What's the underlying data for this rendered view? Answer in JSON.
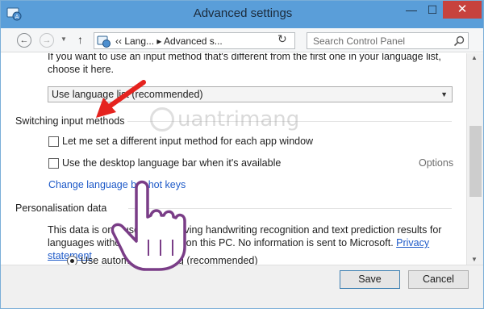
{
  "window": {
    "title": "Advanced settings",
    "minimize": "—",
    "maximize": "☐",
    "close": "✕"
  },
  "toolbar": {
    "back_icon": "←",
    "forward_icon": "→",
    "up_icon": "↑",
    "address": "‹‹  Lang...  ▸  Advanced s...",
    "refresh_icon": "↻",
    "search_placeholder": "Search Control Panel"
  },
  "content": {
    "intro_text": "If you want to use an input method that's different from the first one in your language list, choose it here.",
    "input_method_select": "Use language list (recommended)",
    "switching_heading": "Switching input methods",
    "check_per_app": "Let me set a different input method for each app window",
    "check_desktop_bar": "Use the desktop language bar when it's available",
    "options_link": "Options",
    "hotkeys_link": "Change language bar hot keys",
    "personalisation_heading": "Personalisation data",
    "pers_text_1": "This data is only used to improving handwriting recognition and text prediction results for languages without a dictionary on this PC. No information is sent to Microsoft. ",
    "privacy_link": "Privacy statement",
    "radio_label": "Use automatic learning (recommended)"
  },
  "footer": {
    "save": "Save",
    "cancel": "Cancel"
  },
  "watermark": {
    "text": "uantrimang"
  },
  "colors": {
    "titlebar": "#5a9ed9",
    "close": "#c7423d",
    "link": "#1e5ac8",
    "annotation_arrow": "#e5231f"
  }
}
